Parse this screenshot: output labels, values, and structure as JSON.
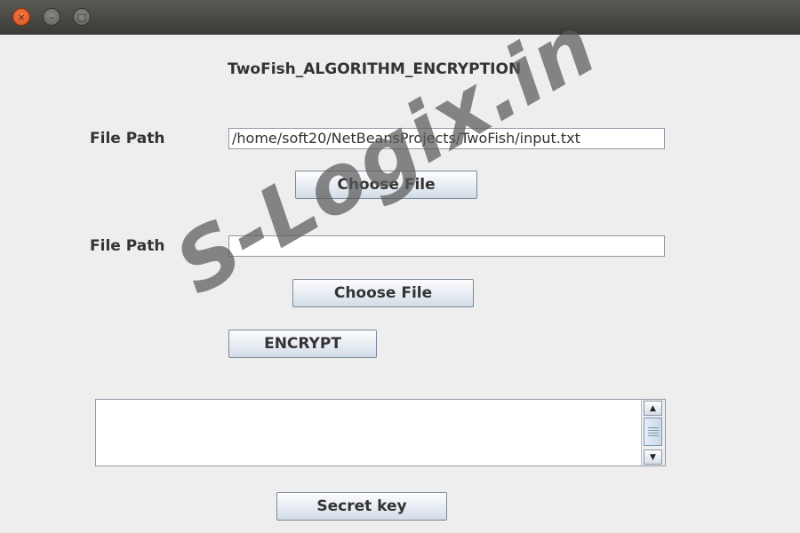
{
  "window": {
    "controls": {
      "close_glyph": "×",
      "minimize_glyph": "–",
      "maximize_glyph": "□"
    }
  },
  "form": {
    "heading": "TwoFish_ALGORITHM_ENCRYPTION",
    "file_path_label_1": "File Path",
    "file_path_value_1": "/home/soft20/NetBeansProjects/TwoFish/input.txt",
    "choose_file_label_1": "Choose File",
    "file_path_label_2": "File Path",
    "file_path_value_2": "",
    "choose_file_label_2": "Choose File",
    "encrypt_label": "ENCRYPT",
    "output_text": "",
    "secret_key_label": "Secret key"
  },
  "watermark": {
    "text": "S-Logix.in",
    "color": "#5a5a5a"
  },
  "colors": {
    "titlebar": "#3c3b37",
    "close_button": "#e05a28",
    "window_bg": "#eeeeee"
  },
  "icons": {
    "close": "close-icon",
    "minimize": "minimize-icon",
    "maximize": "maximize-icon",
    "scroll_up": "triangle-up-icon",
    "scroll_down": "triangle-down-icon"
  }
}
